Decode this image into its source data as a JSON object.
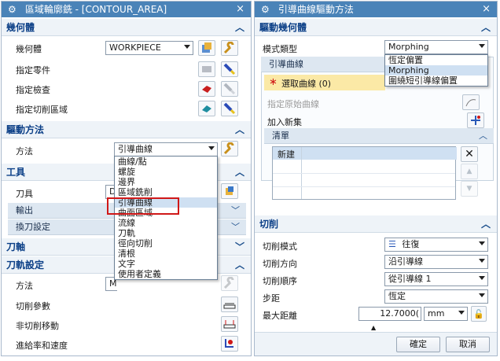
{
  "left": {
    "title": "區域輪廓銑 - [CONTOUR_AREA]",
    "geometry": {
      "header": "幾何體",
      "geom_label": "幾何體",
      "geom_value": "WORKPIECE",
      "part_label": "指定零件",
      "check_label": "指定檢查",
      "cut_area_label": "指定切削區域"
    },
    "drive": {
      "header": "驅動方法",
      "method_label": "方法",
      "method_value": "引導曲線",
      "menu": [
        "曲線/點",
        "螺旋",
        "邊界",
        "區域銑削",
        "引導曲線",
        "曲面區域",
        "流線",
        "刀軌",
        "徑向切削",
        "清根",
        "文字",
        "使用者定義"
      ],
      "menu_selected": "引導曲線"
    },
    "tool": {
      "header": "工具",
      "tool_label": "刀具",
      "tool_value": "D",
      "output_label": "輸出",
      "change_label": "換刀設定"
    },
    "axis": {
      "header": "刀軸"
    },
    "path": {
      "header": "刀軌設定",
      "method_label": "方法",
      "method_value": "M",
      "cut_params": "切削參數",
      "noncut_moves": "非切削移動",
      "feeds_speeds": "進給率和速度"
    }
  },
  "right": {
    "title": "引導曲線驅動方法",
    "drive_geom": {
      "header": "驅動幾何體",
      "mode_label": "模式類型",
      "mode_value": "Morphing",
      "mode_options": [
        "恆定偏置",
        "Morphing",
        "圍繞短引導線偏置"
      ],
      "mode_selected": "Morphing",
      "guide_label": "引導曲線",
      "select_curve_label": "選取曲線 (0)",
      "specify_orig_label": "指定原始曲線",
      "add_new_label": "加入新集",
      "list_header": "清單",
      "list_col": "新建"
    },
    "cut": {
      "header": "切削",
      "pattern_label": "切削模式",
      "pattern_value": "往復",
      "direction_label": "切削方向",
      "direction_value": "沿引導線",
      "order_label": "切削順序",
      "order_value": "從引導線 1",
      "stepover_label": "步距",
      "stepover_value": "恆定",
      "maxdist_label": "最大距離",
      "maxdist_value": "12.7000(",
      "maxdist_unit": "mm"
    },
    "ok_label": "確定",
    "cancel_label": "取消"
  },
  "colors": {
    "title_bar": "#4a83b8",
    "accent_red": "#d01818",
    "selection": "#cfe0f2",
    "highlight_yellow": "#fbe9a6"
  }
}
